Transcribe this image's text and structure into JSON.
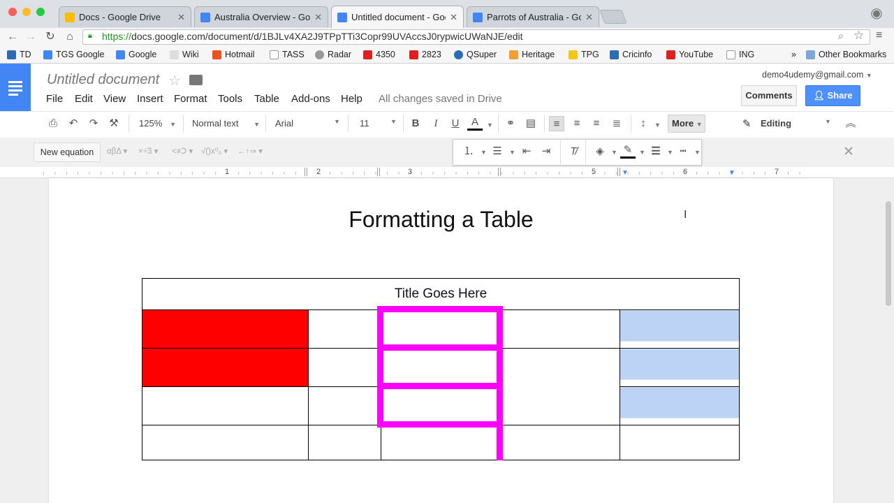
{
  "browser": {
    "tabs": [
      {
        "title": "Docs - Google Drive",
        "favicon_color": "#fbbc04"
      },
      {
        "title": "Australia Overview - Google",
        "favicon_color": "#4285f4"
      },
      {
        "title": "Untitled document - Google",
        "favicon_color": "#4285f4",
        "active": true
      },
      {
        "title": "Parrots of Australia - Google",
        "favicon_color": "#4285f4"
      }
    ],
    "url_scheme": "https://",
    "url_rest": "docs.google.com/document/d/1BJLv4XA2J9TPpTTi3Copr99UVAccsJ0rypwicUWaNJE/edit",
    "bookmarks": [
      "TD",
      "TGS Google",
      "Google",
      "Wiki",
      "Hotmail",
      "TASS",
      "Radar",
      "4350",
      "2823",
      "QSuper",
      "Heritage",
      "TPG",
      "Cricinfo",
      "YouTube",
      "ING"
    ],
    "bookmarks_overflow": "»",
    "other_bookmarks": "Other Bookmarks"
  },
  "docs": {
    "title": "Untitled document",
    "menu": [
      "File",
      "Edit",
      "View",
      "Insert",
      "Format",
      "Tools",
      "Table",
      "Add-ons",
      "Help"
    ],
    "save_status": "All changes saved in Drive",
    "account": "demo4udemy@gmail.com",
    "comments_label": "Comments",
    "share_label": "Share"
  },
  "toolbar": {
    "zoom": "125%",
    "style": "Normal text",
    "font": "Arial",
    "size": "11",
    "more": "More",
    "editing": "Editing"
  },
  "equation": {
    "new_label": "New equation",
    "groups": [
      "αβΔ",
      "×÷3",
      "<≠Ↄ",
      "√()x⁰₀",
      "←↑⇒"
    ]
  },
  "ruler": {
    "numbers": [
      "1",
      "2",
      "3",
      "5",
      "6",
      "7"
    ]
  },
  "document": {
    "heading": "Formatting a Table",
    "table_title": "Title Goes Here"
  },
  "colors": {
    "docs_blue": "#4285f4",
    "cell_red": "#ff0000",
    "cell_blue": "#bcd3f6",
    "border_magenta": "#ff00ff"
  }
}
